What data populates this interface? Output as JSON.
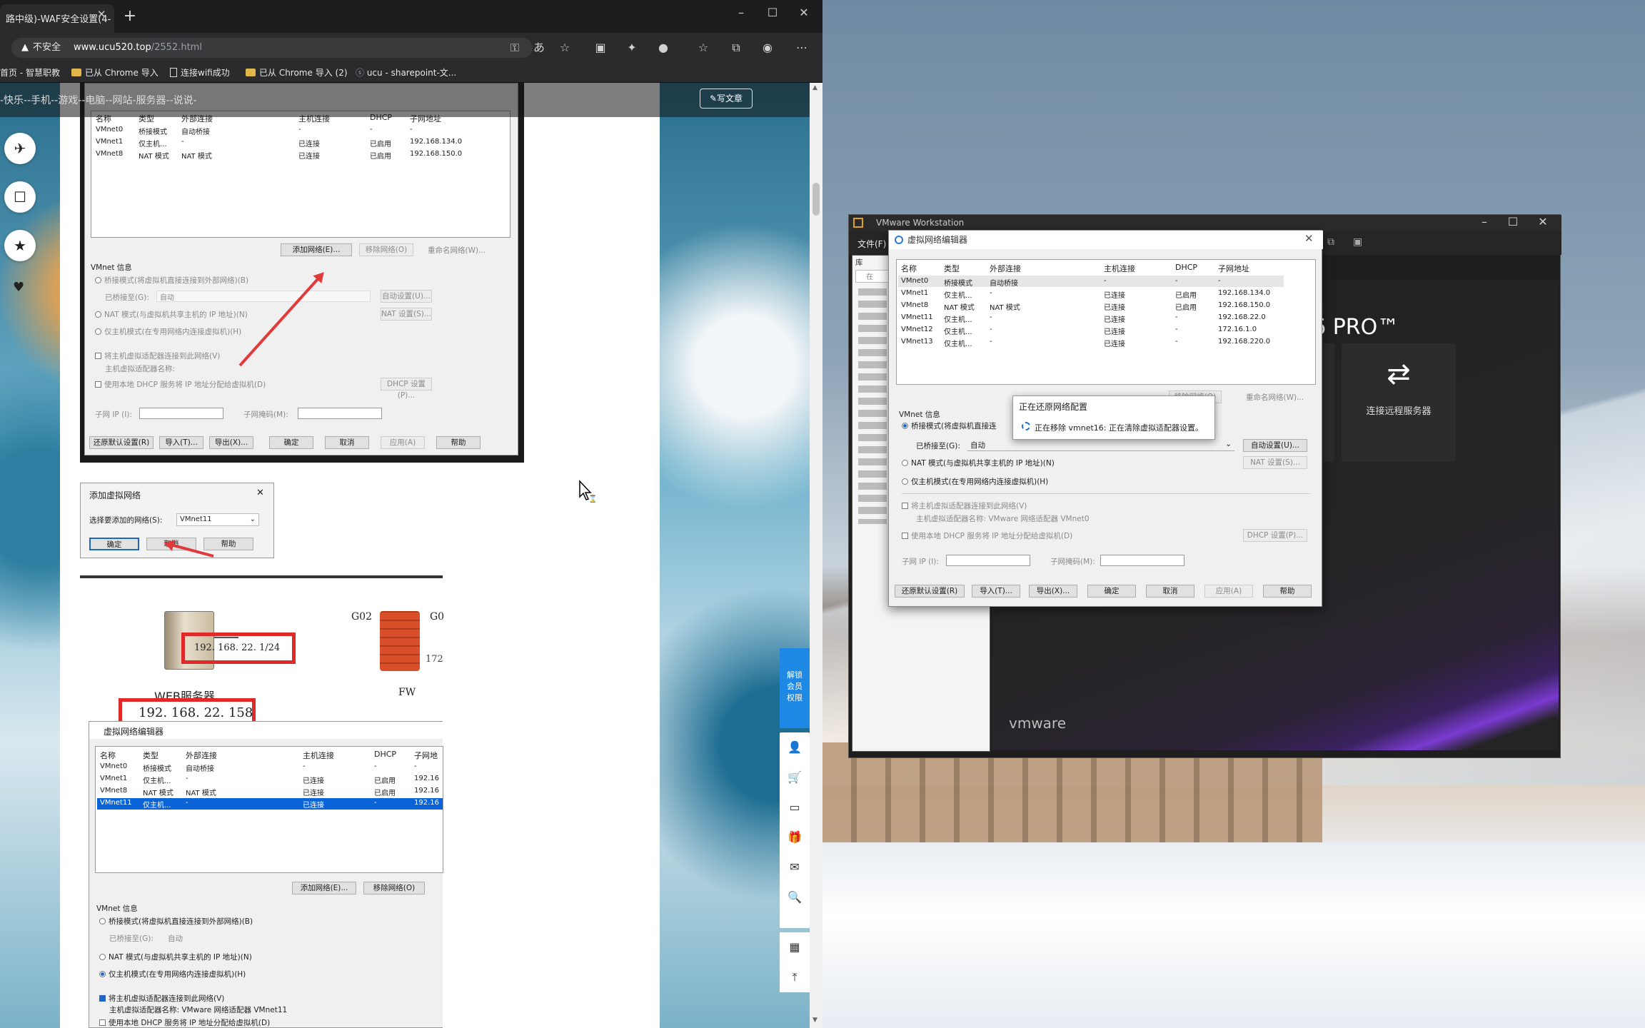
{
  "browser": {
    "tab_title": "路中级)-WAF安全设置(4-",
    "tab_close": "✕",
    "new_tab": "+",
    "win_min": "–",
    "win_max": "☐",
    "win_close": "✕",
    "address": {
      "warning": "▲",
      "insecure": "不安全",
      "host": "www.ucu520.top",
      "path": "/2552.html"
    },
    "bookmarks": [
      {
        "label": "首页 - 智慧职教",
        "kind": "text"
      },
      {
        "label": "已从 Chrome 导入",
        "kind": "folder"
      },
      {
        "label": "连接wifi成功",
        "kind": "page"
      },
      {
        "label": "已从 Chrome 导入 (2)",
        "kind": "folder"
      },
      {
        "label": "ucu - sharepoint-文...",
        "kind": "site"
      }
    ],
    "icons": [
      "key-icon",
      "translate-icon",
      "add-favorite-icon",
      "screen-icon",
      "extension-icon",
      "github-icon",
      "favorites-icon",
      "collections-icon",
      "profile-icon",
      "more-icon"
    ]
  },
  "page": {
    "nav_text": "-快乐--手机--游戏--电脑--网站-服务器--说说-",
    "write_button": "✎写文章",
    "left_fabs": [
      "✈",
      "☐",
      "★"
    ],
    "heart": "♥",
    "vip": [
      "解锁",
      "会员",
      "权限"
    ],
    "side_tools": [
      "👤",
      "🛒",
      "▭",
      "🎁",
      "✉",
      "🔍",
      "▦",
      "⤒"
    ]
  },
  "article_shot1": {
    "headers": [
      "名称",
      "类型",
      "外部连接",
      "主机连接",
      "DHCP",
      "子网地址"
    ],
    "rows": [
      [
        "VMnet0",
        "桥接模式",
        "自动桥接",
        "-",
        "-",
        "-"
      ],
      [
        "VMnet1",
        "仅主机...",
        "-",
        "已连接",
        "已启用",
        "192.168.134.0"
      ],
      [
        "VMnet8",
        "NAT 模式",
        "NAT 模式",
        "已连接",
        "已启用",
        "192.168.150.0"
      ]
    ],
    "add_network": "添加网络(E)...",
    "remove_network": "移除网络(O)",
    "rename_network": "重命名网络(W)...",
    "vmnet_info": "VMnet 信息",
    "bridge_mode": "桥接模式(将虚拟机直接连接到外部网络)(B)",
    "bridged_to": "已桥接至(G):",
    "bridged_value": "自动",
    "auto_settings": "自动设置(U)...",
    "nat_mode": "NAT 模式(与虚拟机共享主机的 IP 地址)(N)",
    "nat_settings": "NAT 设置(S)...",
    "host_only": "仅主机模式(在专用网络内连接虚拟机)(H)",
    "connect_adapter": "将主机虚拟适配器连接到此网络(V)",
    "adapter_name": "主机虚拟适配器名称:",
    "use_dhcp": "使用本地 DHCP 服务将 IP 地址分配给虚拟机(D)",
    "dhcp_settings": "DHCP 设置(P)...",
    "subnet_ip": "子网 IP (I):",
    "subnet_mask": "子网掩码(M):",
    "restore": "还原默认设置(R)",
    "import": "导入(T)...",
    "export": "导出(X)...",
    "ok": "确定",
    "cancel": "取消",
    "apply": "应用(A)",
    "help": "帮助"
  },
  "article_shot2": {
    "title": "添加虚拟网络",
    "close": "✕",
    "select_label": "选择要添加的网络(S):",
    "select_value": "VMnet11",
    "ok": "确定",
    "cancel": "取消",
    "help": "帮助"
  },
  "article_diagram": {
    "g02": "G02",
    "g0": "G0",
    "gw_ip": "192. 168. 22. 1/24",
    "fw_net": "172",
    "fw_label": "FW",
    "server_label": "WEB服务器",
    "server_ip": "192. 168. 22. 158"
  },
  "article_shot3": {
    "title": "虚拟网络编辑器",
    "headers": [
      "名称",
      "类型",
      "外部连接",
      "主机连接",
      "DHCP",
      "子网地"
    ],
    "rows": [
      [
        "VMnet0",
        "桥接模式",
        "自动桥接",
        "-",
        "-",
        "-"
      ],
      [
        "VMnet1",
        "仅主机...",
        "-",
        "已连接",
        "已启用",
        "192.16"
      ],
      [
        "VMnet8",
        "NAT 模式",
        "NAT 模式",
        "已连接",
        "已启用",
        "192.16"
      ],
      [
        "VMnet11",
        "仅主机...",
        "-",
        "已连接",
        "-",
        "192.16"
      ]
    ],
    "add_network": "添加网络(E)...",
    "remove_network": "移除网络(O)",
    "vmnet_info": "VMnet 信息",
    "bridge_mode": "桥接模式(将虚拟机直接连接到外部网络)(B)",
    "bridged_to": "已桥接至(G):",
    "bridged_value": "自动",
    "nat_mode": "NAT 模式(与虚拟机共享主机的 IP 地址)(N)",
    "host_only": "仅主机模式(在专用网络内连接虚拟机)(H)",
    "connect_adapter": "将主机虚拟适配器连接到此网络(V)",
    "adapter_name": "主机虚拟适配器名称: VMware 网络适配器 VMnet11",
    "use_dhcp": "使用本地 DHCP 服务将 IP 地址分配给虚拟机(D)"
  },
  "vmware": {
    "title": "VMware Workstation",
    "menu_file": "文件(F)",
    "lib": "库",
    "search": "在",
    "pro_title": "16 PRO™",
    "remote_label": "连接远程服务器",
    "remote_icon": "⇄",
    "brand": "vmware",
    "win_min": "–",
    "win_max": "☐",
    "win_close": "✕"
  },
  "vne": {
    "title": "虚拟网络编辑器",
    "close": "✕",
    "headers": [
      "名称",
      "类型",
      "外部连接",
      "主机连接",
      "DHCP",
      "子网地址"
    ],
    "rows": [
      [
        "VMnet0",
        "桥接模式",
        "自动桥接",
        "-",
        "-",
        "-"
      ],
      [
        "VMnet1",
        "仅主机...",
        "-",
        "已连接",
        "已启用",
        "192.168.134.0"
      ],
      [
        "VMnet8",
        "NAT 模式",
        "NAT 模式",
        "已连接",
        "已启用",
        "192.168.150.0"
      ],
      [
        "VMnet11",
        "仅主机...",
        "-",
        "已连接",
        "-",
        "192.168.22.0"
      ],
      [
        "VMnet12",
        "仅主机...",
        "-",
        "已连接",
        "-",
        "172.16.1.0"
      ],
      [
        "VMnet13",
        "仅主机...",
        "-",
        "已连接",
        "-",
        "192.168.220.0"
      ]
    ],
    "remove_network": "移除网络(O)",
    "rename_network": "重命名网络(W)...",
    "vmnet_info": "VMnet 信息",
    "bridge_mode": "桥接模式(将虚拟机直接连",
    "bridged_to": "已桥接至(G):",
    "bridged_value": "自动",
    "auto_settings": "自动设置(U)...",
    "nat_mode": "NAT 模式(与虚拟机共享主机的 IP 地址)(N)",
    "nat_settings": "NAT 设置(S)...",
    "host_only": "仅主机模式(在专用网络内连接虚拟机)(H)",
    "connect_adapter": "将主机虚拟适配器连接到此网络(V)",
    "adapter_name": "主机虚拟适配器名称: VMware 网络适配器 VMnet0",
    "use_dhcp": "使用本地 DHCP 服务将 IP 地址分配给虚拟机(D)",
    "dhcp_settings": "DHCP 设置(P)...",
    "subnet_ip": "子网 IP (I):",
    "subnet_mask": "子网掩码(M):",
    "restore": "还原默认设置(R)",
    "import": "导入(T)...",
    "export": "导出(X)...",
    "ok": "确定",
    "cancel": "取消",
    "apply": "应用(A)",
    "help": "帮助"
  },
  "progress": {
    "title": "正在还原网络配置",
    "message": "正在移除 vmnet16: 正在清除虚拟适配器设置。"
  }
}
